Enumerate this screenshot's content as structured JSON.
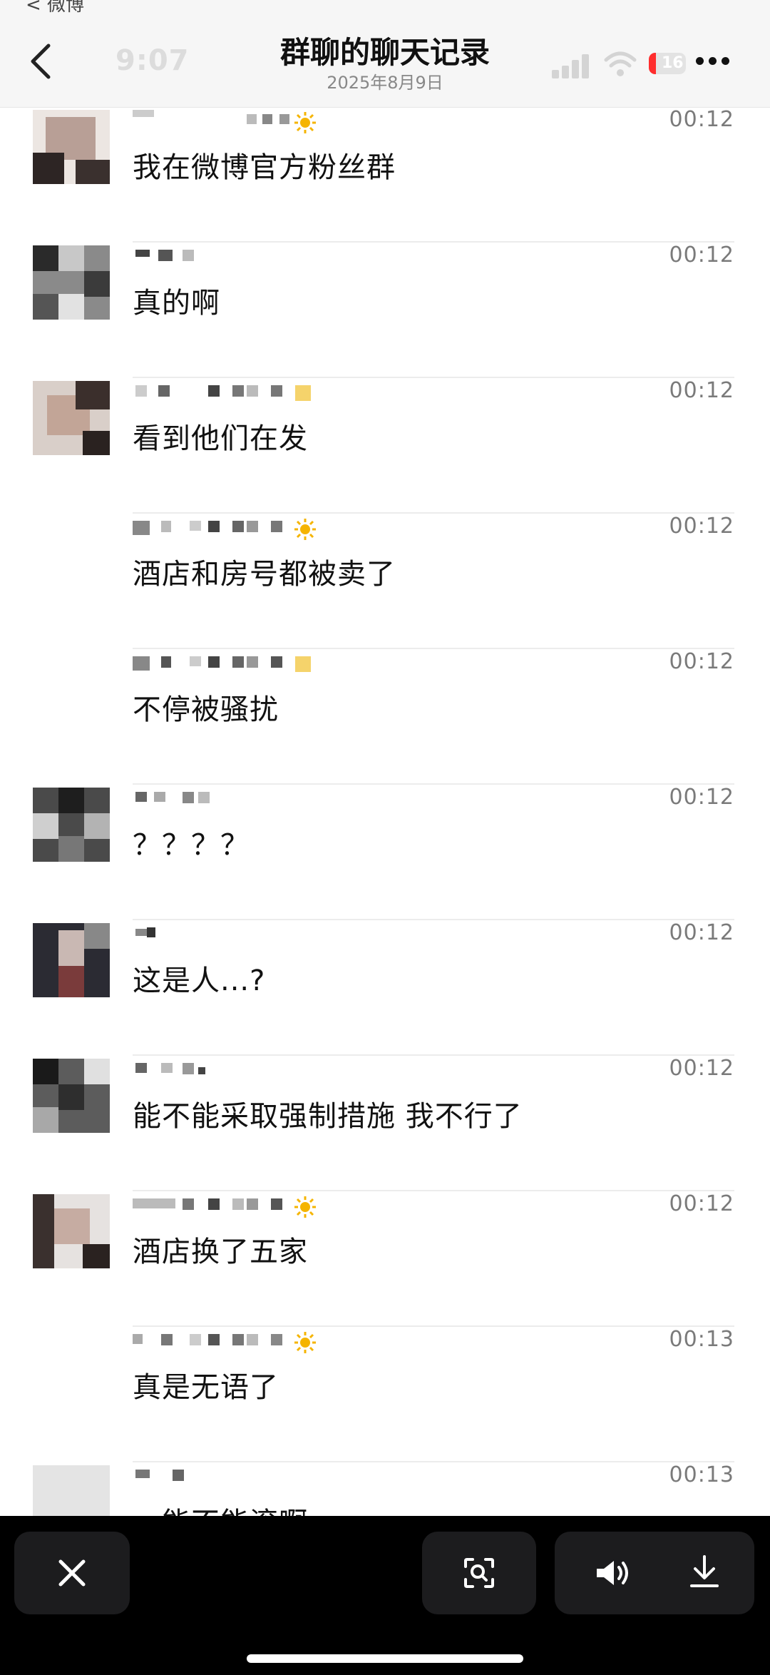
{
  "top_crumb": "< 微博",
  "header": {
    "title": "群聊的聊天记录",
    "date": "2025年8月9日",
    "status_time": "9:07",
    "battery": "16"
  },
  "messages": [
    {
      "time": "00:12",
      "text": "我在微博官方粉丝群",
      "avatar": true,
      "badge": true
    },
    {
      "time": "00:12",
      "text": "真的啊",
      "avatar": true,
      "badge": false
    },
    {
      "time": "00:12",
      "text": "看到他们在发",
      "avatar": true,
      "badge": true
    },
    {
      "time": "00:12",
      "text": "酒店和房号都被卖了",
      "avatar": false,
      "badge": true
    },
    {
      "time": "00:12",
      "text": "不停被骚扰",
      "avatar": false,
      "badge": true
    },
    {
      "time": "00:12",
      "text": "？？？？",
      "avatar": true,
      "badge": false
    },
    {
      "time": "00:12",
      "text": "这是人...?",
      "avatar": true,
      "badge": false
    },
    {
      "time": "00:12",
      "text": "能不能采取强制措施 我不行了",
      "avatar": true,
      "badge": false
    },
    {
      "time": "00:12",
      "text": "酒店换了五家",
      "avatar": true,
      "badge": true
    },
    {
      "time": "00:13",
      "text": "真是无语了",
      "avatar": false,
      "badge": true
    },
    {
      "time": "00:13",
      "text": "…能不能滚啊",
      "avatar": true,
      "badge": false
    }
  ],
  "icons": {
    "back": "chevron-left-icon",
    "more": "more-horizontal-icon",
    "close": "close-icon",
    "scan": "image-search-icon",
    "sound": "speaker-icon",
    "download": "download-icon"
  },
  "colors": {
    "header_bg": "#f6f6f6",
    "badge": "#f5b400",
    "battery": "#ff2d2d",
    "toolbar_bg": "#000000",
    "toolbar_button": "#1c1c1e"
  }
}
